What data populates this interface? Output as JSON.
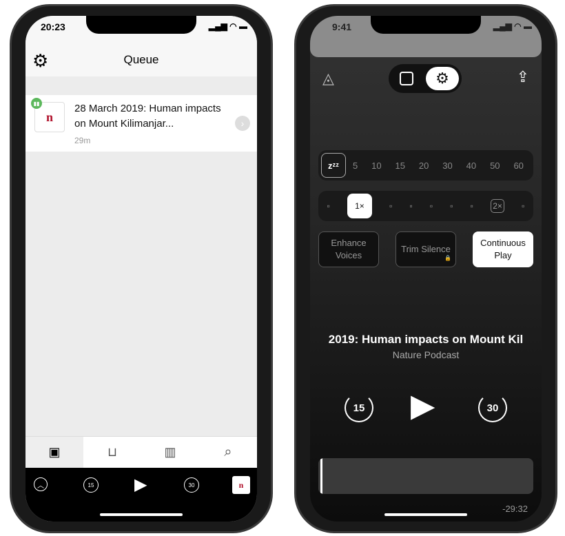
{
  "left": {
    "status_time": "20:23",
    "header_title": "Queue",
    "episode": {
      "title": "28 March 2019: Human impacts on Mount Kilimanjar...",
      "duration": "29m",
      "podcast_art_text": "nature podcast"
    },
    "tabs": [
      "now-playing",
      "inbox",
      "library",
      "search"
    ],
    "mini_player": {
      "skip_back": "15",
      "skip_forward": "30"
    }
  },
  "right": {
    "status_time": "9:41",
    "sleep_timer": {
      "options": [
        "5",
        "10",
        "15",
        "20",
        "30",
        "40",
        "50",
        "60"
      ]
    },
    "speed": {
      "selected": "1×",
      "marker": "2×"
    },
    "toggles": [
      {
        "label": "Enhance Voices",
        "active": false
      },
      {
        "label": "Trim Silence",
        "active": false,
        "locked": true
      },
      {
        "label": "Continuous Play",
        "active": true
      }
    ],
    "now_playing_title": "2019: Human impacts on Mount Kil",
    "podcast_name": "Nature Podcast",
    "skip_back": "15",
    "skip_forward": "30",
    "remaining_time": "-29:32",
    "progress": 0.02
  },
  "colors": {
    "accent_green": "#5cb85c",
    "dark_bg": "#1e1e1e"
  }
}
